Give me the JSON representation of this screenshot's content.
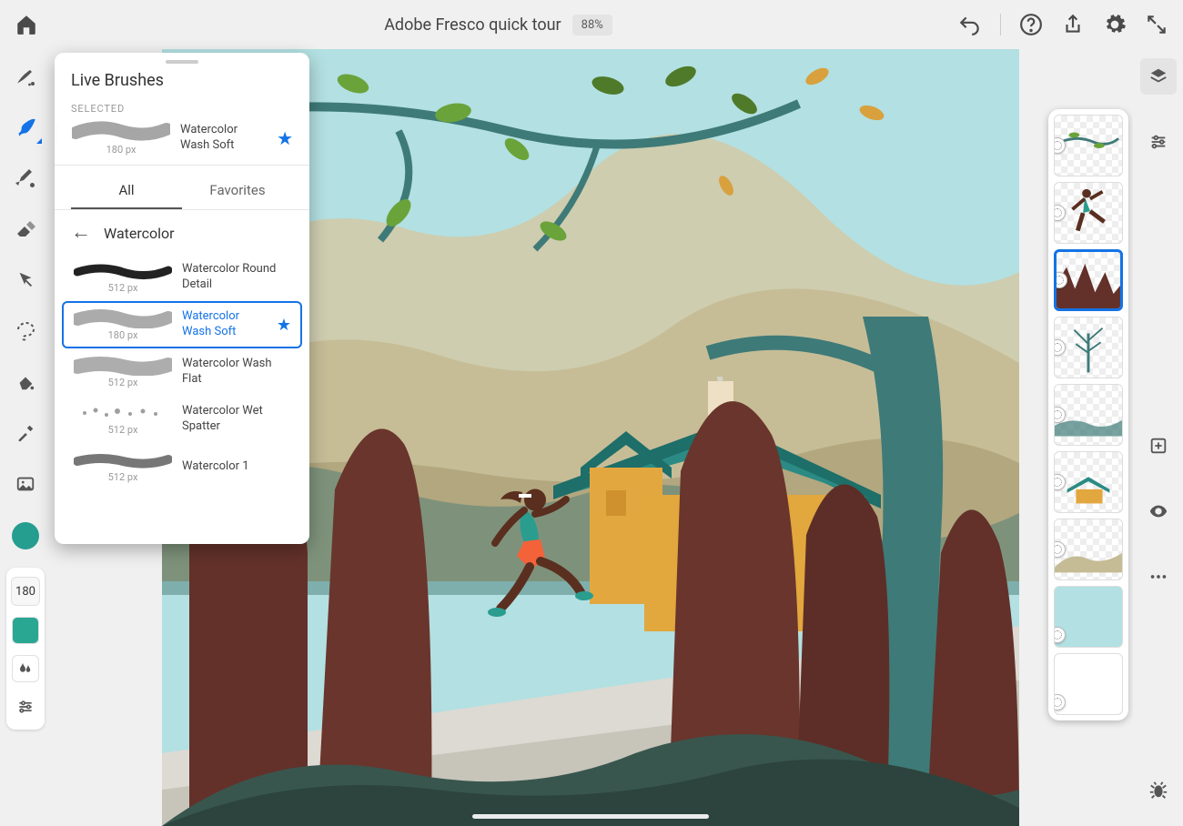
{
  "header": {
    "title": "Adobe Fresco quick tour",
    "zoom": "88%"
  },
  "toolbar": {
    "size_value": "180"
  },
  "popover": {
    "title": "Live Brushes",
    "selected_label": "SELECTED",
    "selected": {
      "name": "Watercolor Wash Soft",
      "size": "180 px"
    },
    "tabs": {
      "all": "All",
      "favorites": "Favorites"
    },
    "category": "Watercolor",
    "brushes": [
      {
        "name": "Watercolor Round Detail",
        "size": "512 px",
        "fav": false,
        "selected": false
      },
      {
        "name": "Watercolor Wash Soft",
        "size": "180 px",
        "fav": true,
        "selected": true
      },
      {
        "name": "Watercolor Wash Flat",
        "size": "512 px",
        "fav": false,
        "selected": false
      },
      {
        "name": "Watercolor Wet Spatter",
        "size": "512 px",
        "fav": false,
        "selected": false
      },
      {
        "name": "Watercolor 1",
        "size": "512 px",
        "fav": false,
        "selected": false
      }
    ]
  },
  "layers": [
    {
      "id": "leaves"
    },
    {
      "id": "runner"
    },
    {
      "id": "trees"
    },
    {
      "id": "bare-tree"
    },
    {
      "id": "water"
    },
    {
      "id": "house"
    },
    {
      "id": "hills"
    },
    {
      "id": "sky"
    },
    {
      "id": "blank"
    }
  ],
  "selected_layer_index": 2,
  "colors": {
    "accent": "#1473e6",
    "current": "#269e8f"
  }
}
